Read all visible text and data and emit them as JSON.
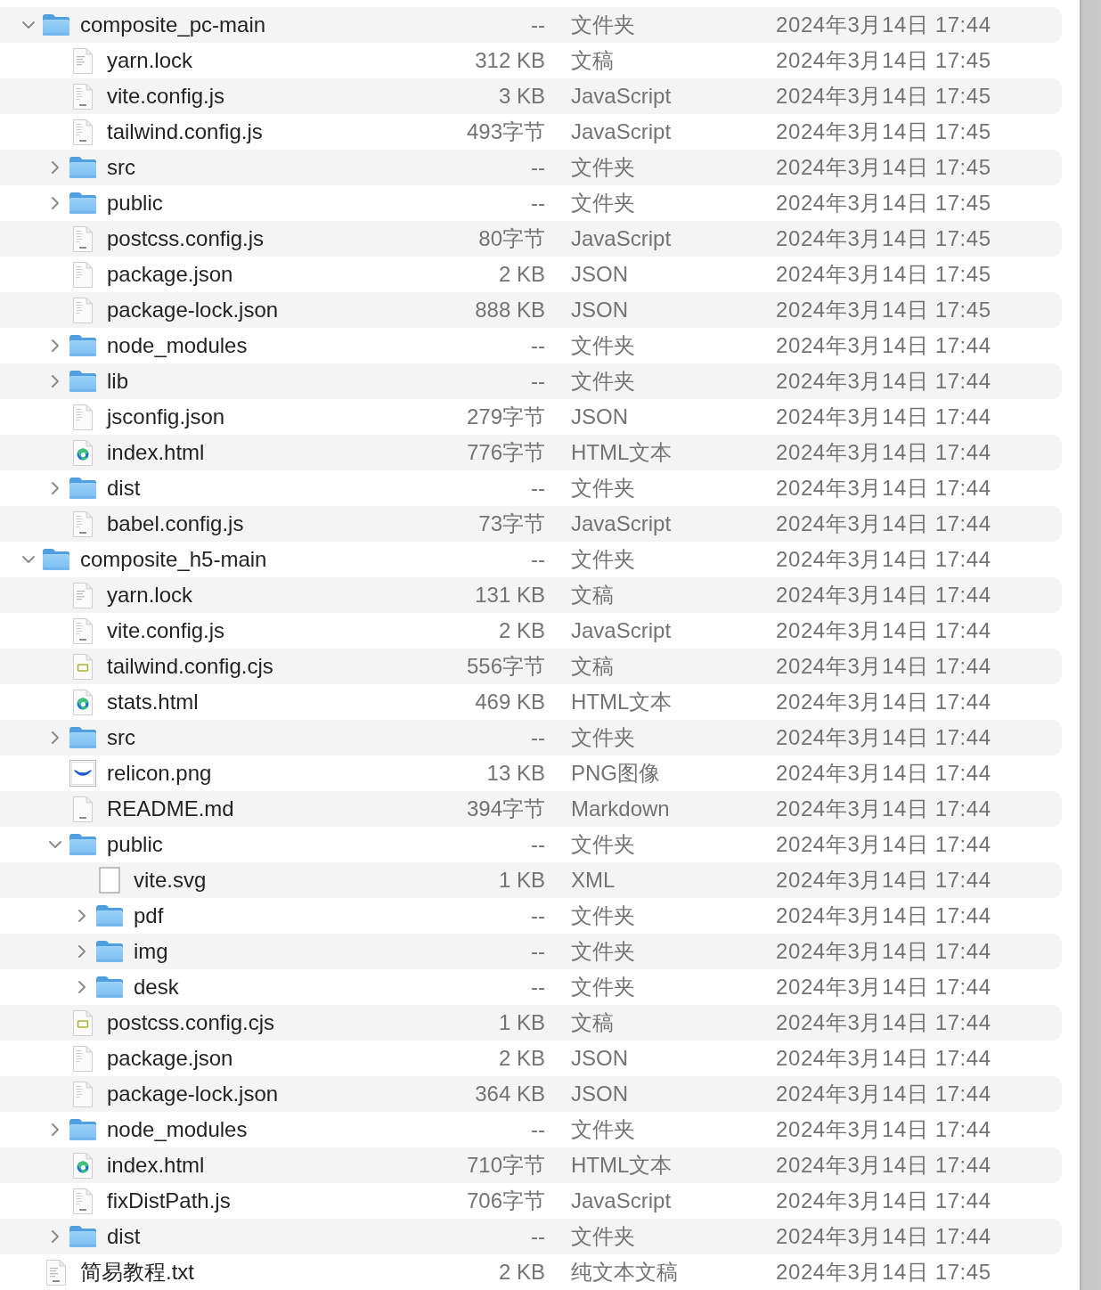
{
  "file_list": {
    "items": [
      {
        "name": "composite_pc-main",
        "kind": "folder",
        "expanded": true,
        "size": "--",
        "file_type": "文件夹",
        "modified": "2024年3月14日 17:44",
        "children": [
          {
            "name": "yarn.lock",
            "kind": "text",
            "size": "312 KB",
            "file_type": "文稿",
            "modified": "2024年3月14日 17:45"
          },
          {
            "name": "vite.config.js",
            "kind": "script",
            "size": "3 KB",
            "file_type": "JavaScript",
            "modified": "2024年3月14日 17:45"
          },
          {
            "name": "tailwind.config.js",
            "kind": "script",
            "size": "493字节",
            "file_type": "JavaScript",
            "modified": "2024年3月14日 17:45"
          },
          {
            "name": "src",
            "kind": "folder",
            "expanded": false,
            "size": "--",
            "file_type": "文件夹",
            "modified": "2024年3月14日 17:45"
          },
          {
            "name": "public",
            "kind": "folder",
            "expanded": false,
            "size": "--",
            "file_type": "文件夹",
            "modified": "2024年3月14日 17:45"
          },
          {
            "name": "postcss.config.js",
            "kind": "script",
            "size": "80字节",
            "file_type": "JavaScript",
            "modified": "2024年3月14日 17:45"
          },
          {
            "name": "package.json",
            "kind": "json",
            "size": "2 KB",
            "file_type": "JSON",
            "modified": "2024年3月14日 17:45"
          },
          {
            "name": "package-lock.json",
            "kind": "json",
            "size": "888 KB",
            "file_type": "JSON",
            "modified": "2024年3月14日 17:45"
          },
          {
            "name": "node_modules",
            "kind": "folder",
            "expanded": false,
            "size": "--",
            "file_type": "文件夹",
            "modified": "2024年3月14日 17:44"
          },
          {
            "name": "lib",
            "kind": "folder",
            "expanded": false,
            "size": "--",
            "file_type": "文件夹",
            "modified": "2024年3月14日 17:44"
          },
          {
            "name": "jsconfig.json",
            "kind": "json",
            "size": "279字节",
            "file_type": "JSON",
            "modified": "2024年3月14日 17:44"
          },
          {
            "name": "index.html",
            "kind": "webpage",
            "size": "776字节",
            "file_type": "HTML文本",
            "modified": "2024年3月14日 17:44"
          },
          {
            "name": "dist",
            "kind": "folder",
            "expanded": false,
            "size": "--",
            "file_type": "文件夹",
            "modified": "2024年3月14日 17:44"
          },
          {
            "name": "babel.config.js",
            "kind": "script",
            "size": "73字节",
            "file_type": "JavaScript",
            "modified": "2024年3月14日 17:44"
          }
        ]
      },
      {
        "name": "composite_h5-main",
        "kind": "folder",
        "expanded": true,
        "size": "--",
        "file_type": "文件夹",
        "modified": "2024年3月14日 17:44",
        "children": [
          {
            "name": "yarn.lock",
            "kind": "text",
            "size": "131 KB",
            "file_type": "文稿",
            "modified": "2024年3月14日 17:44"
          },
          {
            "name": "vite.config.js",
            "kind": "script",
            "size": "2 KB",
            "file_type": "JavaScript",
            "modified": "2024年3月14日 17:44"
          },
          {
            "name": "tailwind.config.cjs",
            "kind": "badge",
            "size": "556字节",
            "file_type": "文稿",
            "modified": "2024年3月14日 17:44"
          },
          {
            "name": "stats.html",
            "kind": "webpage",
            "size": "469 KB",
            "file_type": "HTML文本",
            "modified": "2024年3月14日 17:44"
          },
          {
            "name": "src",
            "kind": "folder",
            "expanded": false,
            "size": "--",
            "file_type": "文件夹",
            "modified": "2024年3月14日 17:44"
          },
          {
            "name": "relicon.png",
            "kind": "image",
            "size": "13 KB",
            "file_type": "PNG图像",
            "modified": "2024年3月14日 17:44"
          },
          {
            "name": "README.md",
            "kind": "markdown",
            "size": "394字节",
            "file_type": "Markdown",
            "modified": "2024年3月14日 17:44"
          },
          {
            "name": "public",
            "kind": "folder",
            "expanded": true,
            "size": "--",
            "file_type": "文件夹",
            "modified": "2024年3月14日 17:44",
            "children": [
              {
                "name": "vite.svg",
                "kind": "blank",
                "size": "1 KB",
                "file_type": "XML",
                "modified": "2024年3月14日 17:44"
              },
              {
                "name": "pdf",
                "kind": "folder",
                "expanded": false,
                "size": "--",
                "file_type": "文件夹",
                "modified": "2024年3月14日 17:44"
              },
              {
                "name": "img",
                "kind": "folder",
                "expanded": false,
                "size": "--",
                "file_type": "文件夹",
                "modified": "2024年3月14日 17:44"
              },
              {
                "name": "desk",
                "kind": "folder",
                "expanded": false,
                "size": "--",
                "file_type": "文件夹",
                "modified": "2024年3月14日 17:44"
              }
            ]
          },
          {
            "name": "postcss.config.cjs",
            "kind": "badge",
            "size": "1 KB",
            "file_type": "文稿",
            "modified": "2024年3月14日 17:44"
          },
          {
            "name": "package.json",
            "kind": "json",
            "size": "2 KB",
            "file_type": "JSON",
            "modified": "2024年3月14日 17:44"
          },
          {
            "name": "package-lock.json",
            "kind": "json",
            "size": "364 KB",
            "file_type": "JSON",
            "modified": "2024年3月14日 17:44"
          },
          {
            "name": "node_modules",
            "kind": "folder",
            "expanded": false,
            "size": "--",
            "file_type": "文件夹",
            "modified": "2024年3月14日 17:44"
          },
          {
            "name": "index.html",
            "kind": "webpage",
            "size": "710字节",
            "file_type": "HTML文本",
            "modified": "2024年3月14日 17:44"
          },
          {
            "name": "fixDistPath.js",
            "kind": "script",
            "size": "706字节",
            "file_type": "JavaScript",
            "modified": "2024年3月14日 17:44"
          },
          {
            "name": "dist",
            "kind": "folder",
            "expanded": false,
            "size": "--",
            "file_type": "文件夹",
            "modified": "2024年3月14日 17:44"
          }
        ]
      },
      {
        "name": "简易教程.txt",
        "kind": "plaintext",
        "size": "2 KB",
        "file_type": "纯文本文稿",
        "modified": "2024年3月14日 17:45"
      }
    ]
  }
}
